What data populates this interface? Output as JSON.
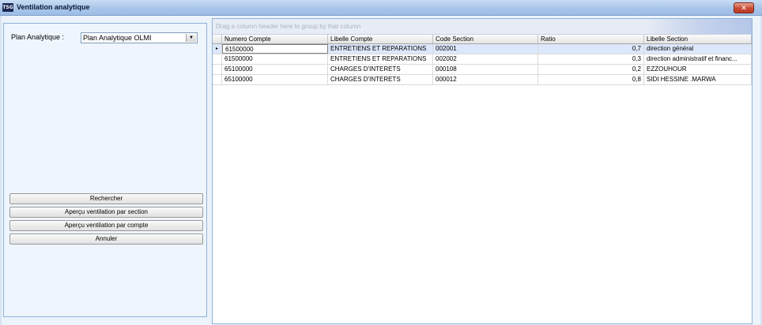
{
  "window": {
    "app_icon": "TSG",
    "title": "Ventilation analytique",
    "close_glyph": "✕"
  },
  "filter": {
    "plan_label": "Plan Analytique :",
    "plan_value": "Plan Analytique OLMI",
    "dropdown_glyph": "▼"
  },
  "buttons": {
    "search": "Rechercher",
    "preview_section": "Aperçu ventilation par section",
    "preview_account": "Aperçu ventilation par compte",
    "cancel": "Annuler"
  },
  "grid": {
    "group_hint": "Drag a column header here to group by that column",
    "columns": [
      "Numero Compte",
      "Libelle Compte",
      "Code Section",
      "Ratio",
      "Libelle Section"
    ],
    "rows": [
      [
        "61500000",
        "ENTRETIENS ET REPARATIONS",
        "002001",
        "0,7",
        "direction général"
      ],
      [
        "61500000",
        "ENTRETIENS ET REPARATIONS",
        "002002",
        "0,3",
        "direction administratif et financ..."
      ],
      [
        "65100000",
        "CHARGES D'INTERETS",
        "000108",
        "0,2",
        "EZZOUHOUR"
      ],
      [
        "65100000",
        "CHARGES D'INTERETS",
        "000012",
        "0,8",
        "SIDI HESSINE .MARWA"
      ]
    ],
    "row_indicator": "▸",
    "selected_row": 0
  },
  "colors": {
    "title_bar": "#a9c6ea",
    "panel_border": "#8db2da",
    "selected_row": "#dde7fb"
  }
}
